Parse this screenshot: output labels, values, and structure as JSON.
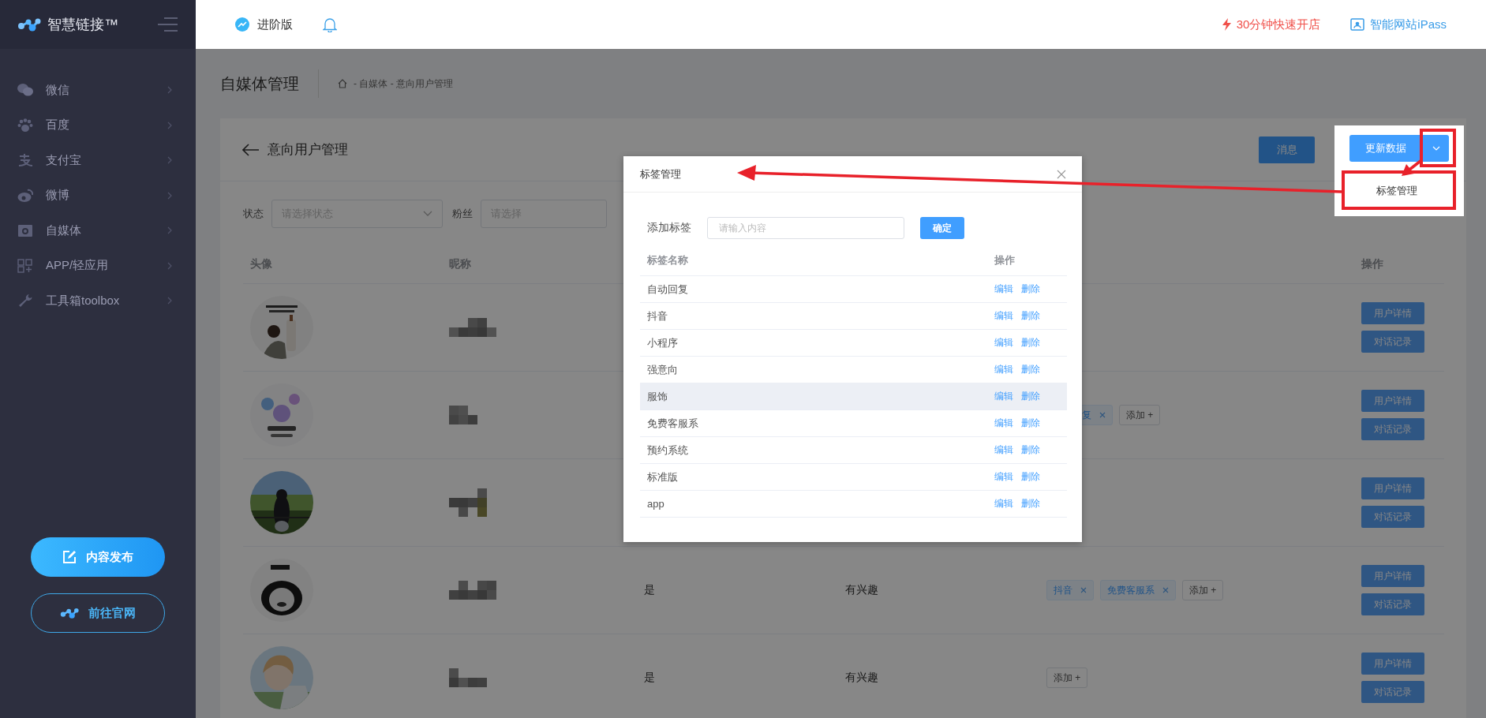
{
  "sidebar": {
    "brand": "智慧链接™",
    "items": [
      {
        "label": "微信"
      },
      {
        "label": "百度"
      },
      {
        "label": "支付宝"
      },
      {
        "label": "微博"
      },
      {
        "label": "自媒体"
      },
      {
        "label": "APP/轻应用"
      },
      {
        "label": "工具箱toolbox"
      }
    ],
    "buttons": [
      {
        "label": "内容发布",
        "kind": "primary"
      },
      {
        "label": "前往官网",
        "kind": "outline"
      }
    ]
  },
  "topbar": {
    "plan": "进阶版",
    "links": [
      {
        "label": "30分钟快速开店",
        "kind": "promo"
      },
      {
        "label": "智能网站iPass",
        "kind": "site"
      }
    ]
  },
  "page": {
    "title": "自媒体管理",
    "breadcrumb": "- 自媒体 - 意向用户管理"
  },
  "card": {
    "title": "意向用户管理",
    "message_button": "消息",
    "filters": [
      {
        "label": "状态",
        "placeholder": "请选择状态",
        "kind": "select"
      },
      {
        "label": "粉丝",
        "placeholder": "请选择",
        "kind": "plain"
      }
    ]
  },
  "table": {
    "columns": [
      "头像",
      "昵称"
    ],
    "action_column": "操作",
    "rows": [
      {
        "actions": [
          "用户详情",
          "对话记录"
        ]
      },
      {
        "tags": [
          {
            "label": "复",
            "partial": true
          }
        ],
        "add": "添加 +",
        "actions": [
          "用户详情",
          "对话记录"
        ]
      },
      {
        "actions": [
          "用户详情",
          "对话记录"
        ]
      },
      {
        "status": "是",
        "interest": "有兴趣",
        "tags": [
          {
            "label": "抖音",
            "partial": false
          },
          {
            "label": "免费客服系",
            "partial": false
          }
        ],
        "add": "添加 +",
        "actions": [
          "用户详情",
          "对话记录"
        ]
      },
      {
        "status": "是",
        "interest": "有兴趣",
        "add": "添加 +",
        "actions": [
          "用户详情",
          "对话记录"
        ]
      }
    ]
  },
  "dropdown": {
    "button": "更新数据",
    "items": [
      "标签管理"
    ]
  },
  "modal": {
    "title": "标签管理",
    "add_label": "添加标签",
    "placeholder": "请输入内容",
    "confirm": "确定",
    "columns": [
      "标签名称",
      "操作"
    ],
    "rows": [
      {
        "name": "自动回复",
        "hovered": false,
        "actions": [
          "编辑",
          "删除"
        ]
      },
      {
        "name": "抖音",
        "hovered": false,
        "actions": [
          "编辑",
          "删除"
        ]
      },
      {
        "name": "小程序",
        "hovered": false,
        "actions": [
          "编辑",
          "删除"
        ]
      },
      {
        "name": "强意向",
        "hovered": false,
        "actions": [
          "编辑",
          "删除"
        ]
      },
      {
        "name": "服饰",
        "hovered": true,
        "actions": [
          "编辑",
          "删除"
        ]
      },
      {
        "name": "免费客服系",
        "hovered": false,
        "actions": [
          "编辑",
          "删除"
        ]
      },
      {
        "name": "预约系统",
        "hovered": false,
        "actions": [
          "编辑",
          "删除"
        ]
      },
      {
        "name": "标准版",
        "hovered": false,
        "actions": [
          "编辑",
          "删除"
        ]
      },
      {
        "name": "app",
        "hovered": false,
        "actions": [
          "编辑",
          "删除"
        ]
      }
    ]
  }
}
